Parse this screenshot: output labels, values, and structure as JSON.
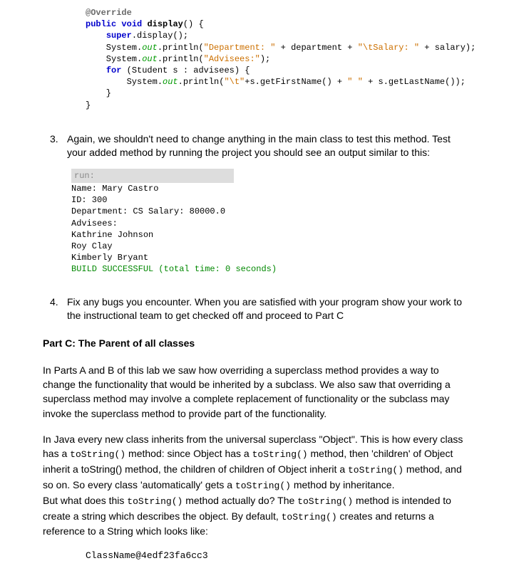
{
  "code": {
    "l1_at": "@Override",
    "l2_kw1": "public",
    "l2_kw2": "void",
    "l2_name": "display",
    "l2_rest": "() {",
    "l3_kw": "super",
    "l3_rest": ".display();",
    "l4a": "    System.",
    "l4b": "out",
    "l4c": ".println(",
    "l4d": "\"Department: \"",
    "l4e": " + department + ",
    "l4f": "\"\\tSalary: \"",
    "l4g": " + salary);",
    "l5a": "    System.",
    "l5b": "out",
    "l5c": ".println(",
    "l5d": "\"Advisees:\"",
    "l5e": ");",
    "l6_kw": "for",
    "l6_rest": " (Student s : advisees) {",
    "l7a": "        System.",
    "l7b": "out",
    "l7c": ".println(",
    "l7d": "\"\\t\"",
    "l7e": "+s.getFirstName() + ",
    "l7f": "\" \"",
    "l7g": " + s.getLastName());",
    "l8": "    }",
    "l9": "}"
  },
  "item3": {
    "num": "3.",
    "text": "Again, we shouldn't need to change anything in the main class to test this method. Test your added method by running the project you should see an output similar to this:"
  },
  "output": {
    "run": "run:",
    "l1": "Name: Mary Castro",
    "l2": "ID: 300",
    "l3": "Department: CS  Salary: 80000.0",
    "l4": "Advisees:",
    "l5": "        Kathrine Johnson",
    "l6": "        Roy Clay",
    "l7": "        Kimberly Bryant",
    "l8": "BUILD SUCCESSFUL (total time: 0 seconds)"
  },
  "item4": {
    "num": "4.",
    "text": " Fix any bugs you encounter. When you are satisfied with your  program show your work to the instructional team to get checked off and proceed to Part C"
  },
  "partC": {
    "head": "Part C: The Parent of all classes",
    "p1": " In Parts A and B of this lab we saw how overriding a superclass method provides a way to change the functionality that would be inherited by a subclass. We also saw that overriding a superclass method may involve a complete replacement of functionality or the subclass may invoke the superclass method to provide part of the functionality.",
    "p2a": " In Java every new class inherits from the universal superclass \"Object\". This is how every class has a ",
    "p2b": " method: since Object has a ",
    "p2c": " method, then 'children' of Object inherit a toString() method, the children of children of Object inherit a ",
    "p2d": " method, and so on. So every class 'automatically' gets a ",
    "p2e": " method by inheritance.",
    "p3a": "But what does this ",
    "p3b": " method actually do? The ",
    "p3c": " method is intended to create a string which describes the object. By default, ",
    "p3d": " creates and returns a reference to a String which looks like:",
    "tostr": "toString()",
    "example": "ClassName@4edf23fa6cc3"
  }
}
